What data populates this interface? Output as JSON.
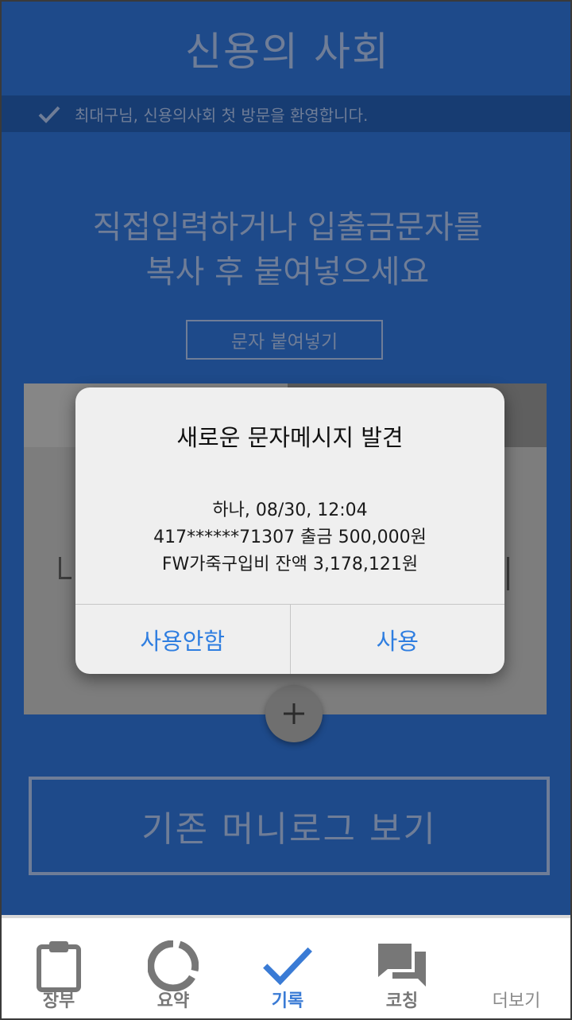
{
  "header": {
    "title": "신용의 사회",
    "welcome_text": "최대구님, 신용의사회 첫 방문을 환영합니다."
  },
  "main": {
    "instruction_line1": "직접입력하거나 입출금문자를",
    "instruction_line2": "복사 후 붙여넣으세요",
    "paste_button": "문자 붙여넣기",
    "moneylog_button": "기존 머니로그 보기"
  },
  "dialog": {
    "title": "새로운 문자메시지 발견",
    "line1": "하나, 08/30, 12:04",
    "line2": "417******71307 출금 500,000원",
    "line3": "FW가죽구입비 잔액 3,178,121원",
    "cancel_label": "사용안함",
    "confirm_label": "사용"
  },
  "bottom_nav": {
    "items": [
      {
        "label": "장부",
        "icon": "clipboard-icon"
      },
      {
        "label": "요약",
        "icon": "donut-chart-icon"
      },
      {
        "label": "기록",
        "icon": "checkmark-icon",
        "active": true
      },
      {
        "label": "코칭",
        "icon": "chat-bubbles-icon"
      },
      {
        "label": "더보기",
        "icon": "more-icon"
      }
    ]
  },
  "colors": {
    "background": "#1e4a8a",
    "accent": "#3a7bd5",
    "dialog_button": "#2f7ee0"
  }
}
